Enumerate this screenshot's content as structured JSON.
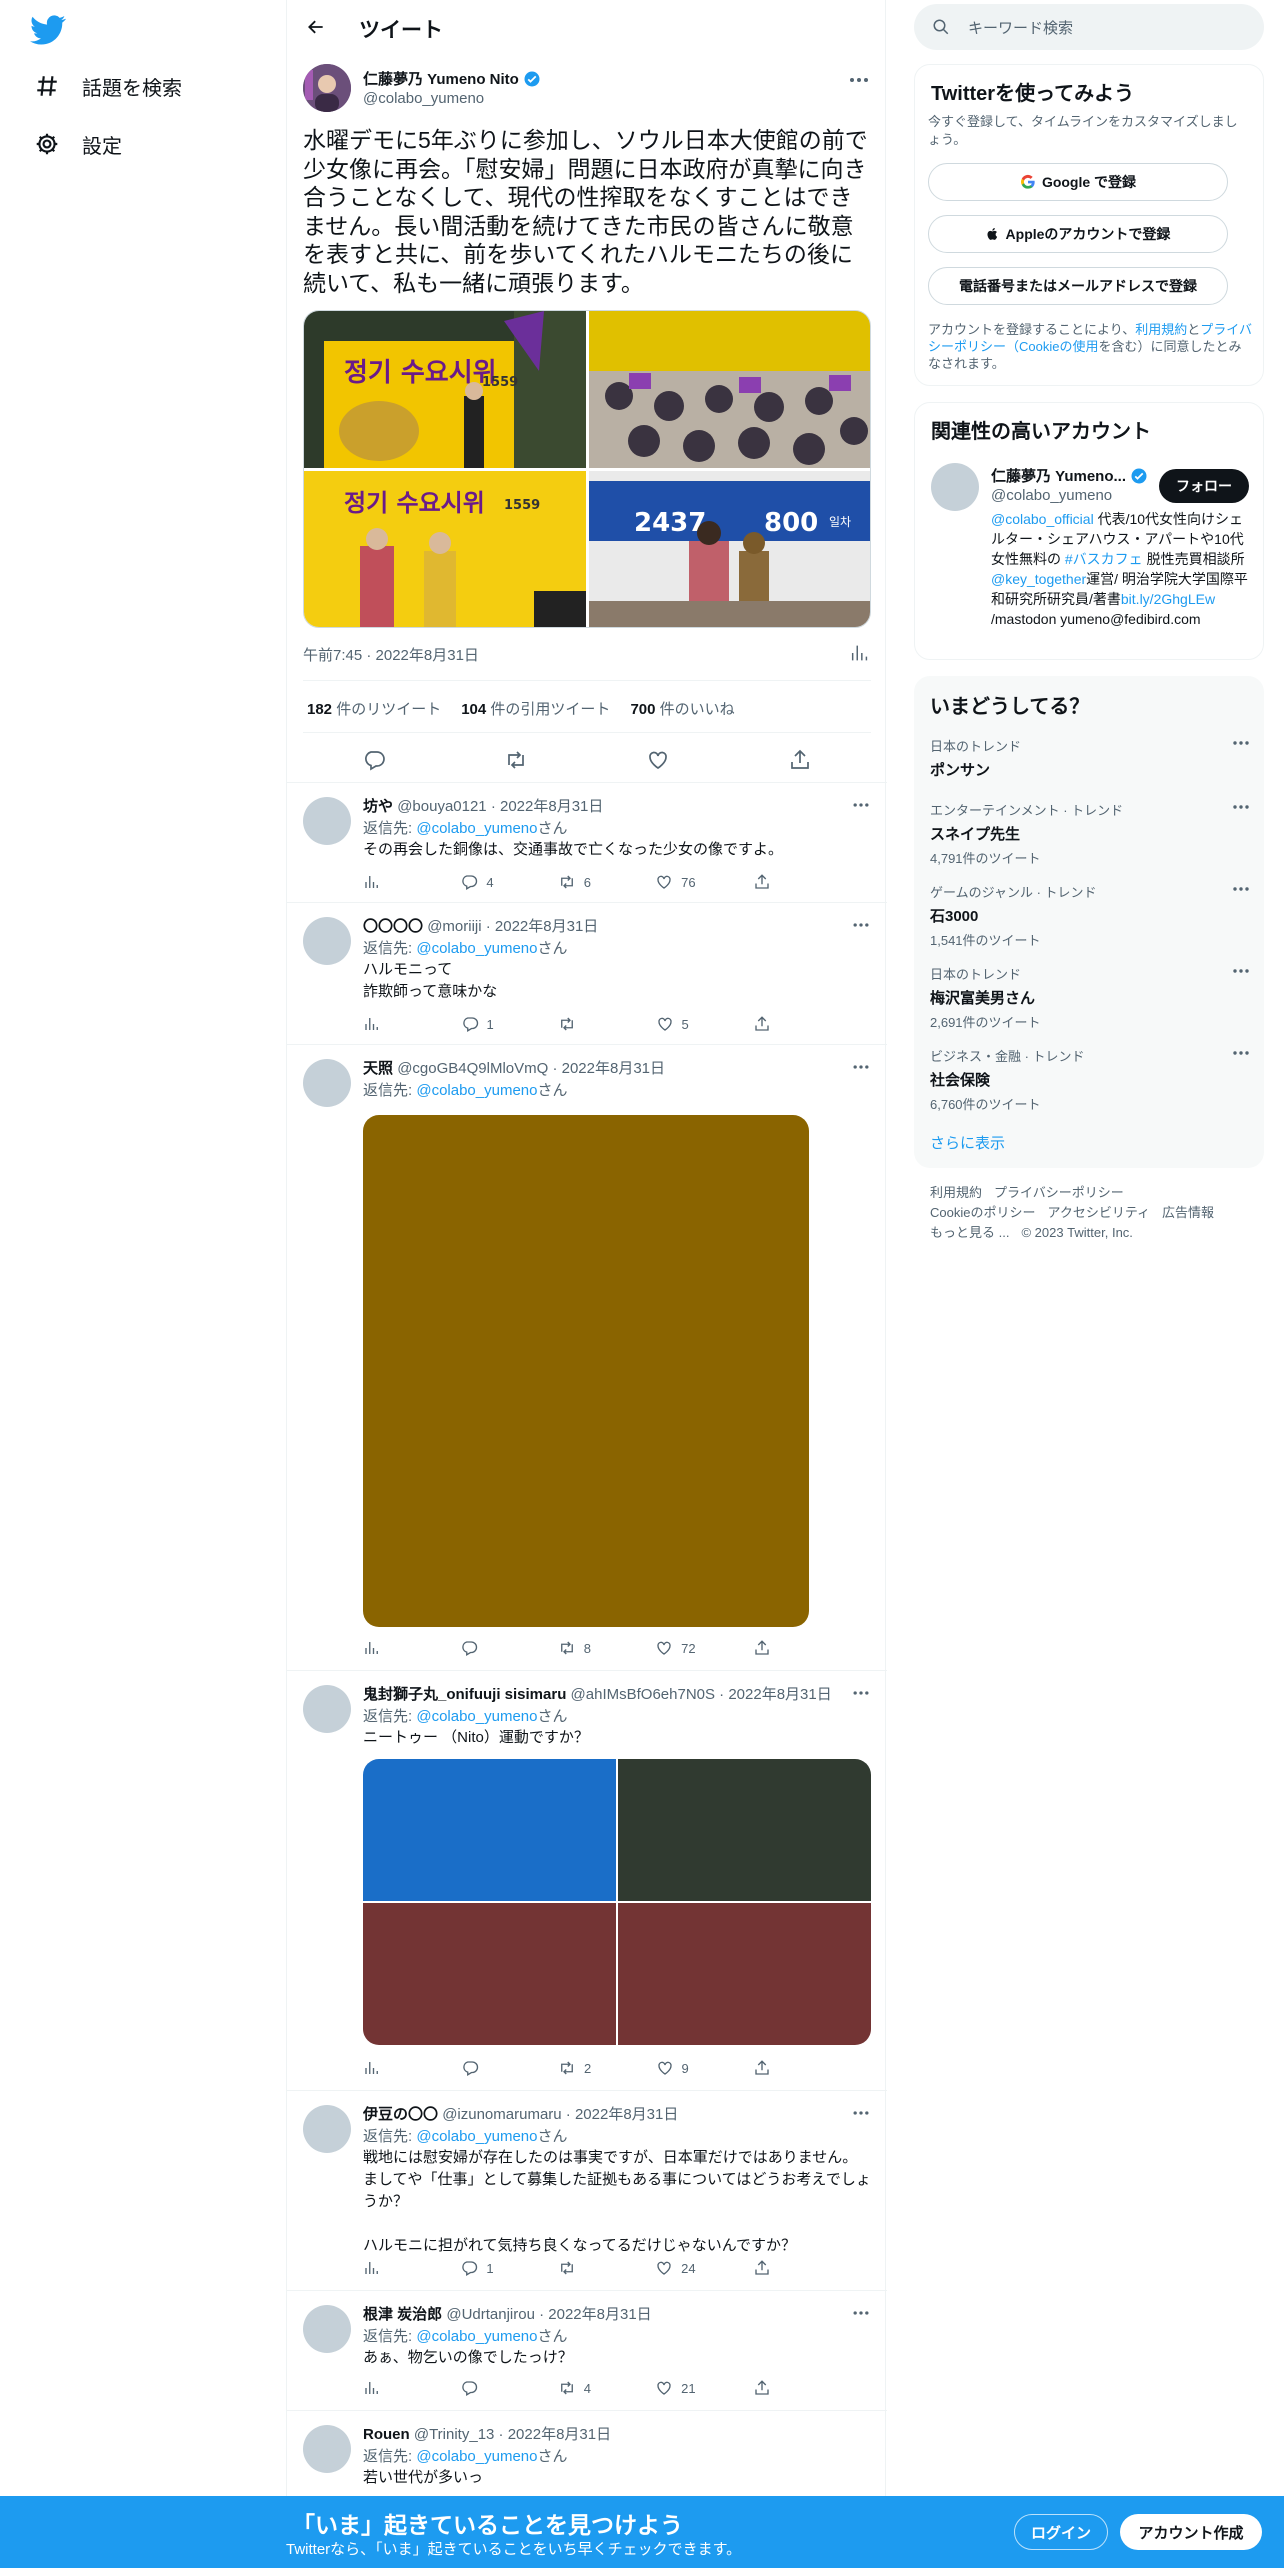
{
  "nav": {
    "explore": "話題を検索",
    "settings": "設定"
  },
  "header": {
    "title": "ツイート"
  },
  "tweet": {
    "name": "仁藤夢乃 Yumeno Nito",
    "handle": "@colabo_yumeno",
    "text": "水曜デモに5年ぶりに参加し、ソウル日本大使館の前で少女像に再会。「慰安婦」問題に日本政府が真摯に向き合うことなくして、現代の性搾取をなくすことはできません。長い間活動を続けてきた市民の皆さんに敬意を表すと共に、前を歩いてくれたハルモニたちの後に続いて、私も一緒に頑張ります。",
    "time": "午前7:45 · 2022年8月31日",
    "retweets": "182",
    "retweets_label": "件のリツイート",
    "quotes": "104",
    "quotes_label": "件の引用ツイート",
    "likes": "700",
    "likes_label": "件のいいね",
    "photo_texts": {
      "p1_title": "정기 수요시위",
      "p1_num": "1559",
      "p3_title": "정기 수요시위",
      "p3_num": "1559",
      "p4_num_a": "2437",
      "p4_num_b": "800",
      "p4_unit": "일차"
    }
  },
  "replies": [
    {
      "name": "坊や",
      "meta": "@bouya0121 · 2022年8月31日",
      "reply_to_prefix": "返信先: ",
      "reply_to": "@colabo_yumeno",
      "reply_to_suffix": "さん",
      "text": "その再会した銅像は、交通事故で亡くなった少女の像ですよ。",
      "replies": "4",
      "retweets": "6",
      "likes": "76"
    },
    {
      "name": "〇〇〇〇",
      "meta": "@moriiji · 2022年8月31日",
      "reply_to_prefix": "返信先: ",
      "reply_to": "@colabo_yumeno",
      "reply_to_suffix": "さん",
      "text": "ハルモニって\n詐欺師って意味かな",
      "replies": "1",
      "retweets": "",
      "likes": "5"
    },
    {
      "name": "天照",
      "meta": "@cgoGB4Q9lMloVmQ · 2022年8月31日",
      "reply_to_prefix": "返信先: ",
      "reply_to": "@colabo_yumeno",
      "reply_to_suffix": "さん",
      "text": "",
      "replies": "",
      "retweets": "8",
      "likes": "72"
    },
    {
      "name": "鬼封獅子丸_onifuuji sisimaru",
      "meta": "@ahIMsBfO6eh7N0S · 2022年8月31日",
      "reply_to_prefix": "返信先: ",
      "reply_to": "@colabo_yumeno",
      "reply_to_suffix": "さん",
      "text": "ニートゥー （Nito）運動ですか？",
      "replies": "",
      "retweets": "2",
      "likes": "9"
    },
    {
      "name": "伊豆の〇〇",
      "meta": "@izunomarumaru · 2022年8月31日",
      "reply_to_prefix": "返信先: ",
      "reply_to": "@colabo_yumeno",
      "reply_to_suffix": "さん",
      "text": "戦地には慰安婦が存在したのは事実ですが、日本軍だけではありません。\nましてや「仕事」として募集した証拠もある事についてはどうお考えでしょうか？\n\nハルモニに担がれて気持ち良くなってるだけじゃないんですか？",
      "replies": "1",
      "retweets": "",
      "likes": "24"
    },
    {
      "name": "根津 炭治郎",
      "meta": "@Udrtanjirou · 2022年8月31日",
      "reply_to_prefix": "返信先: ",
      "reply_to": "@colabo_yumeno",
      "reply_to_suffix": "さん",
      "text": "あぁ、物乞いの像でしたっけ？",
      "replies": "",
      "retweets": "4",
      "likes": "21"
    },
    {
      "name": "Rouen",
      "meta": "@Trinity_13 · 2022年8月31日",
      "reply_to_prefix": "返信先: ",
      "reply_to": "@colabo_yumeno",
      "reply_to_suffix": "さん",
      "text": "若い世代が多いっ"
    }
  ],
  "right": {
    "search_placeholder": "キーワード検索",
    "signup": {
      "title": "Twitterを使ってみよう",
      "sub": "今すぐ登録して、タイムラインをカスタマイズしましょう。",
      "google": "Google で登録",
      "apple": "Appleのアカウントで登録",
      "phone": "電話番号またはメールアドレスで登録",
      "terms_1": "アカウントを登録することにより、",
      "terms_link_1": "利用規約",
      "terms_2": "と",
      "terms_link_2": "プライバシーポリシー（Cookieの使用",
      "terms_3": "を含む）に同意したとみなされます。"
    },
    "related": {
      "title": "関連性の高いアカウント",
      "name": "仁藤夢乃 Yumeno...",
      "handle": "@colabo_yumeno",
      "follow": "フォロー",
      "bio_link_1": "@colabo_official",
      "bio_1": " 代表/10代女性向けシェルター・シェアハウス・アパートや10代女性無料の ",
      "bio_link_2": "#バスカフェ",
      "bio_2": " 脱性売買相談所 ",
      "bio_link_3": "@key_together",
      "bio_3": "運営/ 明治学院大学国際平和研究所研究員/著書",
      "bio_link_4": "bit.ly/2GhgLEw",
      "bio_4": " /mastodon yumeno@fedibird.com"
    },
    "trends": {
      "title": "いまどうしてる？",
      "items": [
        {
          "cat": "日本のトレンド",
          "name": "ポンサン",
          "count": ""
        },
        {
          "cat": "エンターテインメント · トレンド",
          "name": "スネイプ先生",
          "count": "4,791件のツイート"
        },
        {
          "cat": "ゲームのジャンル · トレンド",
          "name": "石3000",
          "count": "1,541件のツイート"
        },
        {
          "cat": "日本のトレンド",
          "name": "梅沢富美男さん",
          "count": "2,691件のツイート"
        },
        {
          "cat": "ビジネス・金融 · トレンド",
          "name": "社会保険",
          "count": "6,760件のツイート"
        }
      ],
      "show_more": "さらに表示"
    },
    "footer": {
      "terms": "利用規約",
      "privacy": "プライバシーポリシー",
      "cookie": "Cookieのポリシー",
      "access": "アクセシビリティ",
      "ads": "広告情報",
      "more": "もっと見る ...",
      "copy": "© 2023 Twitter, Inc."
    }
  },
  "bottom": {
    "title": "「いま」起きていることを見つけよう",
    "sub": "Twitterなら、「いま」起きていることをいち早くチェックできます。",
    "login": "ログイン",
    "signup": "アカウント作成"
  },
  "colors": {
    "accent": "#1d9bf0",
    "text": "#0f1419",
    "muted": "#536471",
    "reply3_image": "#8a6400"
  }
}
